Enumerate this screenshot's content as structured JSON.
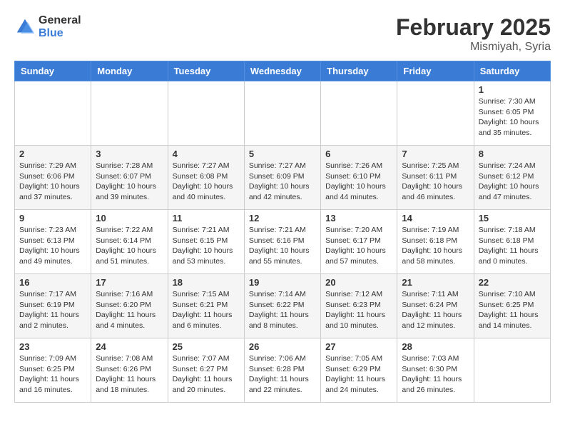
{
  "header": {
    "logo_general": "General",
    "logo_blue": "Blue",
    "month_title": "February 2025",
    "location": "Mismiyah, Syria"
  },
  "weekdays": [
    "Sunday",
    "Monday",
    "Tuesday",
    "Wednesday",
    "Thursday",
    "Friday",
    "Saturday"
  ],
  "weeks": [
    [
      {
        "day": "",
        "info": ""
      },
      {
        "day": "",
        "info": ""
      },
      {
        "day": "",
        "info": ""
      },
      {
        "day": "",
        "info": ""
      },
      {
        "day": "",
        "info": ""
      },
      {
        "day": "",
        "info": ""
      },
      {
        "day": "1",
        "info": "Sunrise: 7:30 AM\nSunset: 6:05 PM\nDaylight: 10 hours\nand 35 minutes."
      }
    ],
    [
      {
        "day": "2",
        "info": "Sunrise: 7:29 AM\nSunset: 6:06 PM\nDaylight: 10 hours\nand 37 minutes."
      },
      {
        "day": "3",
        "info": "Sunrise: 7:28 AM\nSunset: 6:07 PM\nDaylight: 10 hours\nand 39 minutes."
      },
      {
        "day": "4",
        "info": "Sunrise: 7:27 AM\nSunset: 6:08 PM\nDaylight: 10 hours\nand 40 minutes."
      },
      {
        "day": "5",
        "info": "Sunrise: 7:27 AM\nSunset: 6:09 PM\nDaylight: 10 hours\nand 42 minutes."
      },
      {
        "day": "6",
        "info": "Sunrise: 7:26 AM\nSunset: 6:10 PM\nDaylight: 10 hours\nand 44 minutes."
      },
      {
        "day": "7",
        "info": "Sunrise: 7:25 AM\nSunset: 6:11 PM\nDaylight: 10 hours\nand 46 minutes."
      },
      {
        "day": "8",
        "info": "Sunrise: 7:24 AM\nSunset: 6:12 PM\nDaylight: 10 hours\nand 47 minutes."
      }
    ],
    [
      {
        "day": "9",
        "info": "Sunrise: 7:23 AM\nSunset: 6:13 PM\nDaylight: 10 hours\nand 49 minutes."
      },
      {
        "day": "10",
        "info": "Sunrise: 7:22 AM\nSunset: 6:14 PM\nDaylight: 10 hours\nand 51 minutes."
      },
      {
        "day": "11",
        "info": "Sunrise: 7:21 AM\nSunset: 6:15 PM\nDaylight: 10 hours\nand 53 minutes."
      },
      {
        "day": "12",
        "info": "Sunrise: 7:21 AM\nSunset: 6:16 PM\nDaylight: 10 hours\nand 55 minutes."
      },
      {
        "day": "13",
        "info": "Sunrise: 7:20 AM\nSunset: 6:17 PM\nDaylight: 10 hours\nand 57 minutes."
      },
      {
        "day": "14",
        "info": "Sunrise: 7:19 AM\nSunset: 6:18 PM\nDaylight: 10 hours\nand 58 minutes."
      },
      {
        "day": "15",
        "info": "Sunrise: 7:18 AM\nSunset: 6:18 PM\nDaylight: 11 hours\nand 0 minutes."
      }
    ],
    [
      {
        "day": "16",
        "info": "Sunrise: 7:17 AM\nSunset: 6:19 PM\nDaylight: 11 hours\nand 2 minutes."
      },
      {
        "day": "17",
        "info": "Sunrise: 7:16 AM\nSunset: 6:20 PM\nDaylight: 11 hours\nand 4 minutes."
      },
      {
        "day": "18",
        "info": "Sunrise: 7:15 AM\nSunset: 6:21 PM\nDaylight: 11 hours\nand 6 minutes."
      },
      {
        "day": "19",
        "info": "Sunrise: 7:14 AM\nSunset: 6:22 PM\nDaylight: 11 hours\nand 8 minutes."
      },
      {
        "day": "20",
        "info": "Sunrise: 7:12 AM\nSunset: 6:23 PM\nDaylight: 11 hours\nand 10 minutes."
      },
      {
        "day": "21",
        "info": "Sunrise: 7:11 AM\nSunset: 6:24 PM\nDaylight: 11 hours\nand 12 minutes."
      },
      {
        "day": "22",
        "info": "Sunrise: 7:10 AM\nSunset: 6:25 PM\nDaylight: 11 hours\nand 14 minutes."
      }
    ],
    [
      {
        "day": "23",
        "info": "Sunrise: 7:09 AM\nSunset: 6:25 PM\nDaylight: 11 hours\nand 16 minutes."
      },
      {
        "day": "24",
        "info": "Sunrise: 7:08 AM\nSunset: 6:26 PM\nDaylight: 11 hours\nand 18 minutes."
      },
      {
        "day": "25",
        "info": "Sunrise: 7:07 AM\nSunset: 6:27 PM\nDaylight: 11 hours\nand 20 minutes."
      },
      {
        "day": "26",
        "info": "Sunrise: 7:06 AM\nSunset: 6:28 PM\nDaylight: 11 hours\nand 22 minutes."
      },
      {
        "day": "27",
        "info": "Sunrise: 7:05 AM\nSunset: 6:29 PM\nDaylight: 11 hours\nand 24 minutes."
      },
      {
        "day": "28",
        "info": "Sunrise: 7:03 AM\nSunset: 6:30 PM\nDaylight: 11 hours\nand 26 minutes."
      },
      {
        "day": "",
        "info": ""
      }
    ]
  ]
}
